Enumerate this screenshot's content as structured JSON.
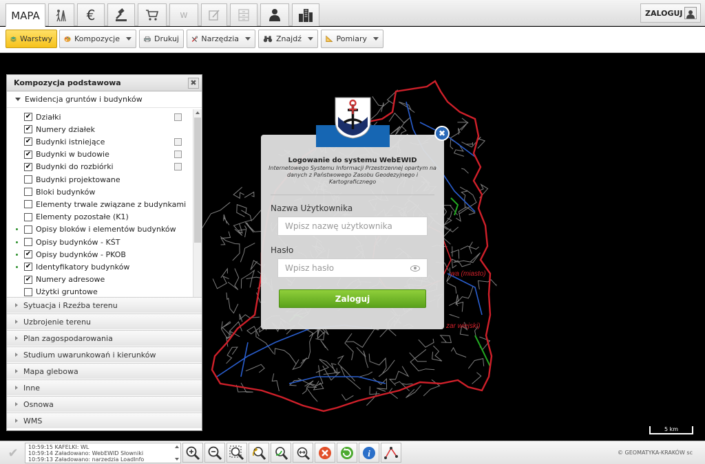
{
  "tabs": {
    "mapa_label": "MAPA",
    "icons": [
      "surveyor-icon",
      "euro-icon",
      "gavel-icon",
      "cart-icon",
      "wfs-icon",
      "edit-form-icon",
      "cabinet-icon",
      "person-icon",
      "buildings-icon"
    ],
    "wfs_glyph": "W",
    "login_label": "ZALOGUJ"
  },
  "toolbar": {
    "layers_label": "Warstwy",
    "compositions_label": "Kompozycje",
    "print_label": "Drukuj",
    "tools_label": "Narzędzia",
    "find_label": "Znajdź",
    "measure_label": "Pomiary"
  },
  "panel": {
    "title": "Kompozycja podstawowa",
    "close_glyph": "✖",
    "open_group": "Ewidencja gruntów i budynków",
    "layers": [
      {
        "label": "Działki",
        "checked": true,
        "legend": true,
        "dot": false
      },
      {
        "label": "Numery działek",
        "checked": true,
        "legend": false,
        "dot": false
      },
      {
        "label": "Budynki istniejące",
        "checked": true,
        "legend": true,
        "dot": false
      },
      {
        "label": "Budynki w budowie",
        "checked": true,
        "legend": true,
        "dot": false
      },
      {
        "label": "Budynki do rozbiórki",
        "checked": true,
        "legend": true,
        "dot": false
      },
      {
        "label": "Budynki projektowane",
        "checked": false,
        "legend": false,
        "dot": false
      },
      {
        "label": "Bloki budynków",
        "checked": false,
        "legend": false,
        "dot": false
      },
      {
        "label": "Elementy trwale związane z budynkami",
        "checked": false,
        "legend": false,
        "dot": false
      },
      {
        "label": "Elementy pozostałe (K1)",
        "checked": false,
        "legend": false,
        "dot": false
      },
      {
        "label": "Opisy bloków i elementów budynków",
        "checked": false,
        "legend": false,
        "dot": true
      },
      {
        "label": "Opisy budynków - KŚT",
        "checked": false,
        "legend": false,
        "dot": true
      },
      {
        "label": "Opisy budynków - PKOB",
        "checked": true,
        "legend": false,
        "dot": true
      },
      {
        "label": "Identyfikatory budynków",
        "checked": true,
        "legend": false,
        "dot": true
      },
      {
        "label": "Numery adresowe",
        "checked": true,
        "legend": false,
        "dot": false
      },
      {
        "label": "Użytki gruntowe",
        "checked": false,
        "legend": false,
        "dot": false
      }
    ],
    "groups": [
      "Sytuacja i Rzeźba terenu",
      "Uzbrojenie terenu",
      "Plan zagospodarowania",
      "Studium uwarunkowań i kierunków",
      "Mapa glebowa",
      "Inne",
      "Osnowa",
      "WMS"
    ]
  },
  "map": {
    "label_city": "wa (miasto)",
    "label_rural": "zar wiejski)",
    "scale_label": "5 km"
  },
  "login": {
    "title": "Logowanie do systemu WebEWID",
    "subtitle": "Internetowego Systemu Informacji Przestrzennej opartym na danych z Państwowego Zasobu Geodezyjnego i Kartograficznego",
    "username_label": "Nazwa Użytkownika",
    "username_placeholder": "Wpisz nazwę użytkownika",
    "password_label": "Hasło",
    "password_placeholder": "Wpisz hasło",
    "submit_label": "Zaloguj",
    "close_glyph": "✖"
  },
  "statusbar": {
    "log": [
      "10:59:15 KAFELKI: WL",
      "10:59:14 Załadowano: WebEWID Słowniki",
      "10:59:13 Załadowano: narzedzia LoadInfo"
    ],
    "tools": [
      "zoom-in-icon",
      "zoom-out-icon",
      "zoom-extent-icon",
      "zoom-previous-icon",
      "zoom-next-icon",
      "zoom-selection-icon",
      "clear-icon",
      "refresh-icon",
      "info-icon",
      "distance-icon"
    ],
    "copyright": "© GEOMATYKA-KRAKÓW sc"
  },
  "colors": {
    "boundary": "#d0202a",
    "roads": "#7f7f7f",
    "blue_lines": "#2a5fd0",
    "green_lines": "#22aa22",
    "active_button": "#f6c21b",
    "login_button": "#6cb52a",
    "crest_band": "#1666b3"
  }
}
